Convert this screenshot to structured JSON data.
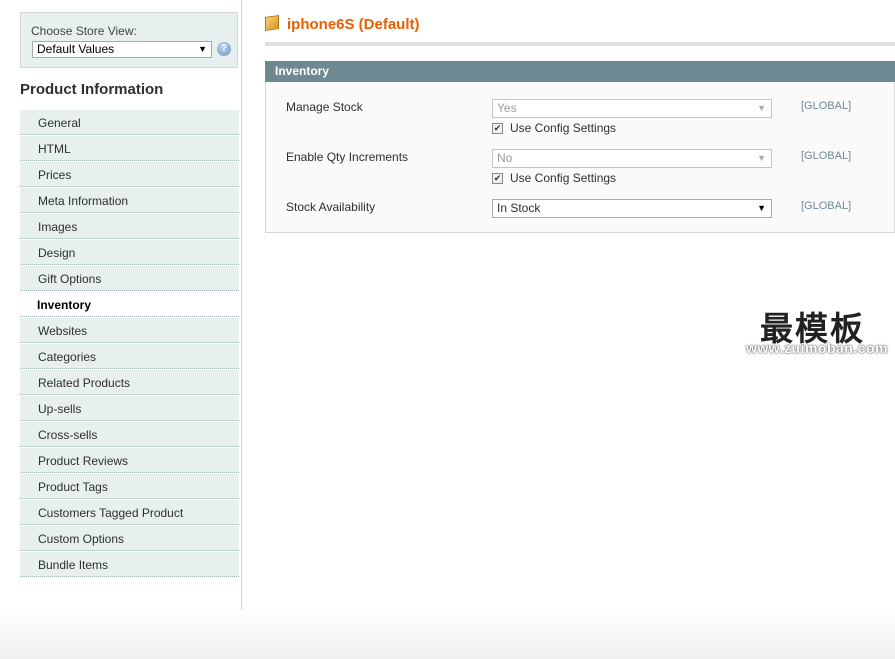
{
  "store_switcher": {
    "label": "Choose Store View:",
    "selected": "Default Values",
    "help_icon": "help-icon"
  },
  "sidebar": {
    "title": "Product Information",
    "tabs": [
      {
        "label": "General"
      },
      {
        "label": "HTML"
      },
      {
        "label": "Prices"
      },
      {
        "label": "Meta Information"
      },
      {
        "label": "Images"
      },
      {
        "label": "Design"
      },
      {
        "label": "Gift Options"
      },
      {
        "label": "Inventory",
        "active": true
      },
      {
        "label": "Websites"
      },
      {
        "label": "Categories"
      },
      {
        "label": "Related Products"
      },
      {
        "label": "Up-sells"
      },
      {
        "label": "Cross-sells"
      },
      {
        "label": "Product Reviews"
      },
      {
        "label": "Product Tags"
      },
      {
        "label": "Customers Tagged Product"
      },
      {
        "label": "Custom Options"
      },
      {
        "label": "Bundle Items"
      }
    ]
  },
  "page": {
    "icon": "product-box-icon",
    "title": "iphone6S (Default)"
  },
  "inventory": {
    "legend": "Inventory",
    "fields": [
      {
        "label": "Manage Stock",
        "value": "Yes",
        "disabled": true,
        "use_config_label": "Use Config Settings",
        "use_config_checked": true,
        "scope": "[GLOBAL]"
      },
      {
        "label": "Enable Qty Increments",
        "value": "No",
        "disabled": true,
        "use_config_label": "Use Config Settings",
        "use_config_checked": true,
        "scope": "[GLOBAL]"
      },
      {
        "label": "Stock Availability",
        "value": "In Stock",
        "disabled": false,
        "scope": "[GLOBAL]"
      }
    ]
  },
  "watermark": {
    "text": "最模板",
    "url": "www.zuimoban.com"
  },
  "colors": {
    "title_orange": "#eb5e00",
    "section_header": "#6f8992",
    "tab_bg": "#e7efef",
    "scope_text": "#6f8992"
  }
}
